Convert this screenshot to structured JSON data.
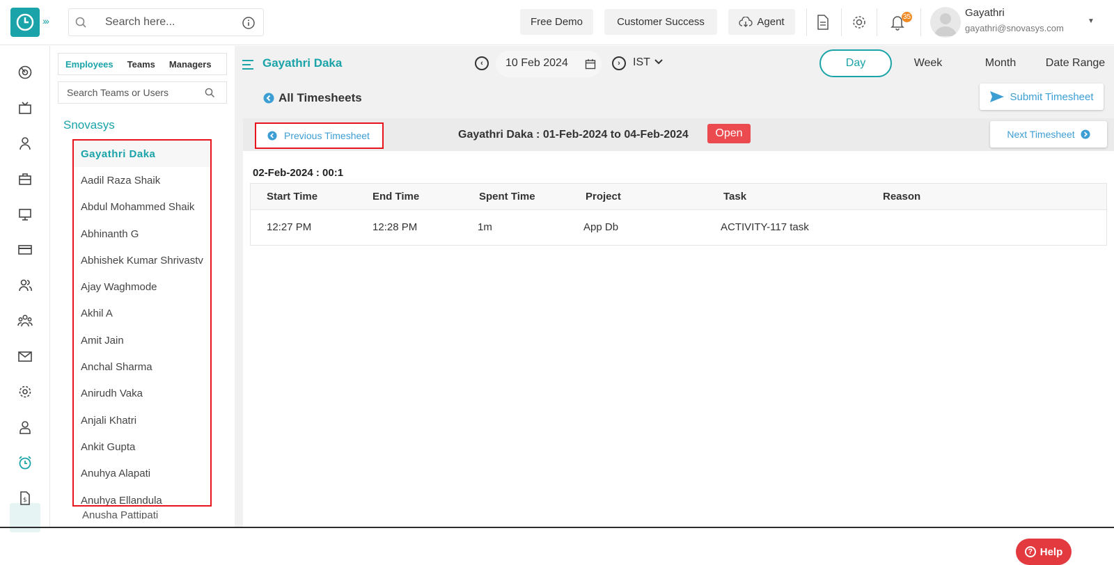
{
  "header": {
    "search_placeholder": "Search here...",
    "free_demo": "Free Demo",
    "customer_success": "Customer Success",
    "agent": "Agent",
    "notification_count": "35",
    "user_name": "Gayathri",
    "user_email": "gayathri@snovasys.com"
  },
  "panel": {
    "tabs": [
      "Employees",
      "Teams",
      "Managers"
    ],
    "search_placeholder": "Search Teams or Users",
    "org": "Snovasys",
    "employees": [
      "Gayathri Daka",
      "Aadil Raza Shaik",
      "Abdul Mohammed Shaik",
      "Abhinanth G",
      "Abhishek Kumar Shrivastv",
      "Ajay Waghmode",
      "Akhil A",
      "Amit Jain",
      "Anchal Sharma",
      "Anirudh Vaka",
      "Anjali Khatri",
      "Ankit Gupta",
      "Anuhya Alapati",
      "Anuhya Ellandula"
    ],
    "next_partial": "Anusha Pattipati"
  },
  "main": {
    "employee_name": "Gayathri Daka",
    "date": "10 Feb 2024",
    "timezone": "IST",
    "range_tabs": [
      "Day",
      "Week",
      "Month",
      "Date Range"
    ],
    "all_timesheets": "All Timesheets",
    "submit": "Submit Timesheet",
    "previous": "Previous Timesheet",
    "next": "Next Timesheet",
    "range_title": "Gayathri Daka : 01-Feb-2024 to 04-Feb-2024",
    "status": "Open",
    "day_label": "02-Feb-2024 : 00:1",
    "columns": [
      "Start Time",
      "End Time",
      "Spent Time",
      "Project",
      "Task",
      "Reason"
    ],
    "rows": [
      [
        "12:27 PM",
        "12:28 PM",
        "1m",
        "App Db",
        "ACTIVITY-117 task",
        ""
      ]
    ],
    "help": "Help"
  },
  "colors": {
    "accent": "#1aa3a8",
    "link": "#3d9ed4",
    "status_open": "#eb4a4f",
    "highlight_box": "#e8141c",
    "badge": "#f08a24"
  }
}
